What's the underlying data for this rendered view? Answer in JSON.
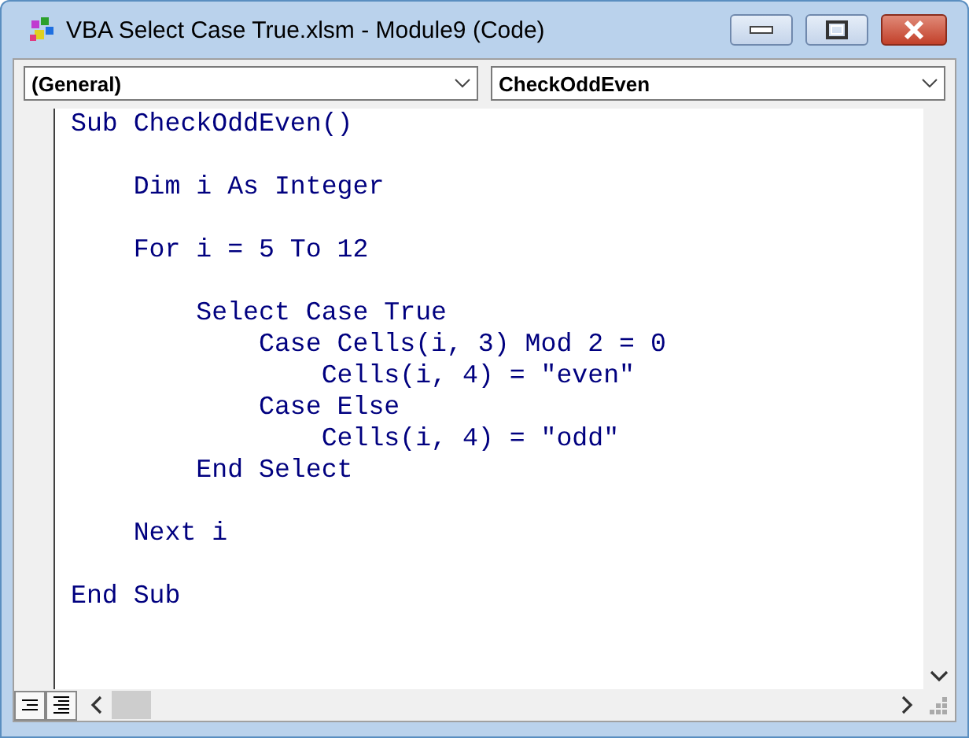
{
  "window": {
    "title": "VBA Select Case True.xlsm - Module9 (Code)"
  },
  "object_dropdown": {
    "value": "(General)"
  },
  "procedure_dropdown": {
    "value": "CheckOddEven"
  },
  "code_lines": [
    {
      "kind": "code",
      "text": "Sub CheckOddEven()"
    },
    {
      "kind": "blank"
    },
    {
      "kind": "code",
      "text": "    Dim i As Integer"
    },
    {
      "kind": "blank"
    },
    {
      "kind": "code",
      "text": "    For i = 5 To 12"
    },
    {
      "kind": "blank"
    },
    {
      "kind": "code",
      "text": "        Select Case True"
    },
    {
      "kind": "code",
      "text": "            Case Cells(i, 3) Mod 2 = 0"
    },
    {
      "kind": "code",
      "text": "                Cells(i, 4) = \"even\""
    },
    {
      "kind": "code",
      "text": "            Case Else"
    },
    {
      "kind": "code",
      "text": "                Cells(i, 4) = \"odd\""
    },
    {
      "kind": "code",
      "text": "        End Select"
    },
    {
      "kind": "blank"
    },
    {
      "kind": "code",
      "text": "    Next i"
    },
    {
      "kind": "blank"
    },
    {
      "kind": "code",
      "text": "End Sub"
    }
  ]
}
